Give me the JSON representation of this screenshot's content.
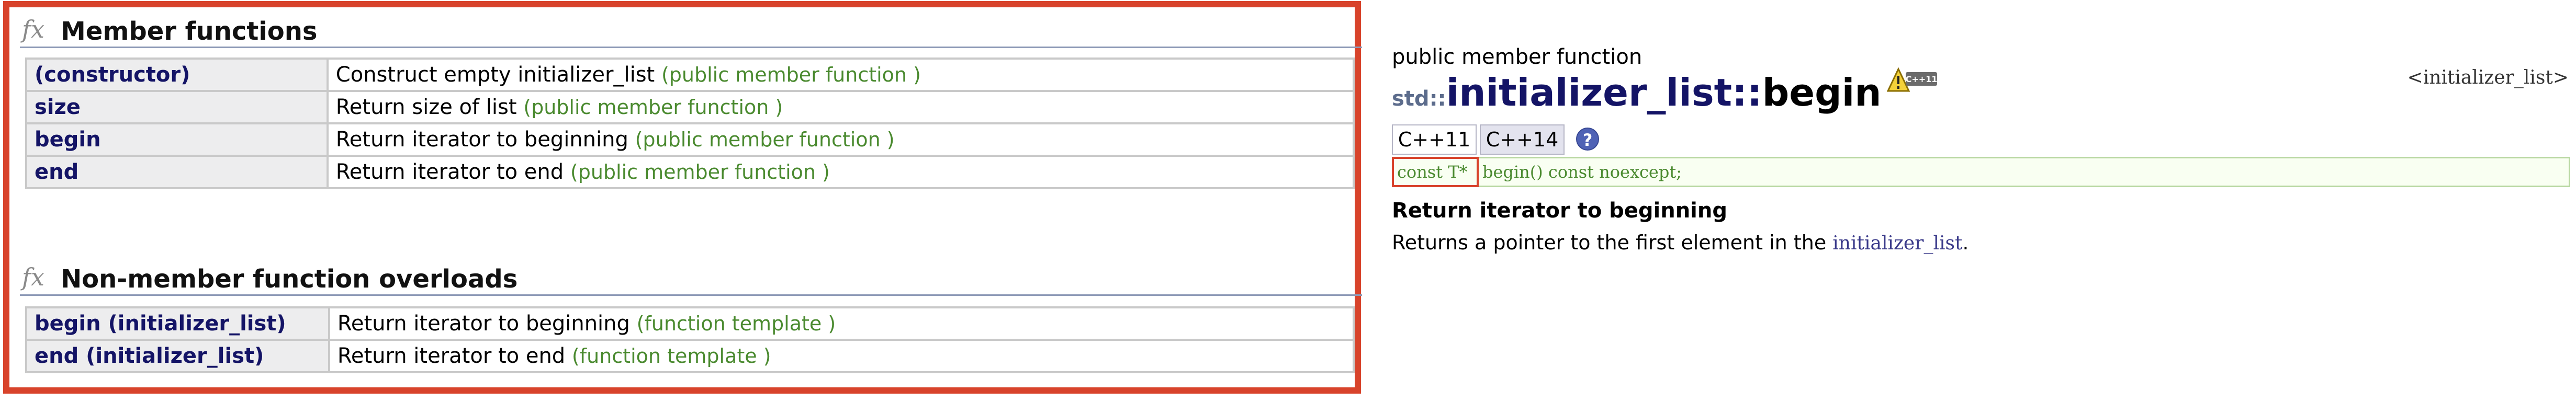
{
  "member_section": {
    "icon": "fx-icon",
    "title": "Member functions",
    "rows": [
      {
        "name": "(constructor)",
        "desc": "Construct empty initializer_list",
        "kind": "(public member function )"
      },
      {
        "name": "size",
        "desc": "Return size of list",
        "kind": "(public member function )"
      },
      {
        "name": "begin",
        "desc": "Return iterator to beginning",
        "kind": "(public member function )"
      },
      {
        "name": "end",
        "desc": "Return iterator to end",
        "kind": "(public member function )"
      }
    ]
  },
  "nonmember_section": {
    "icon": "fx-icon",
    "title": "Non-member function overloads",
    "rows": [
      {
        "name": "begin (initializer_list)",
        "desc": "Return iterator to beginning",
        "kind": "(function template )"
      },
      {
        "name": "end (initializer_list)",
        "desc": "Return iterator to end",
        "kind": "(function template )"
      }
    ]
  },
  "detail": {
    "kind": "public member function",
    "namespace": "std::",
    "class_name": "initializer_list",
    "separator": "::",
    "function_name": "begin",
    "badge_label": "C++11",
    "header": "<initializer_list>",
    "tabs": [
      {
        "label": "C++11",
        "active": true
      },
      {
        "label": "C++14",
        "active": false
      }
    ],
    "help_label": "?",
    "signature_return": "const T*",
    "signature_rest": "begin() const noexcept;",
    "summary_heading": "Return iterator to beginning",
    "summary_prefix": "Returns a pointer to the first element in the ",
    "summary_code": "initializer_list",
    "summary_suffix": "."
  },
  "colors": {
    "highlight_border": "#d8432b",
    "name_text": "#141466",
    "kind_note": "#4a8a2f"
  }
}
